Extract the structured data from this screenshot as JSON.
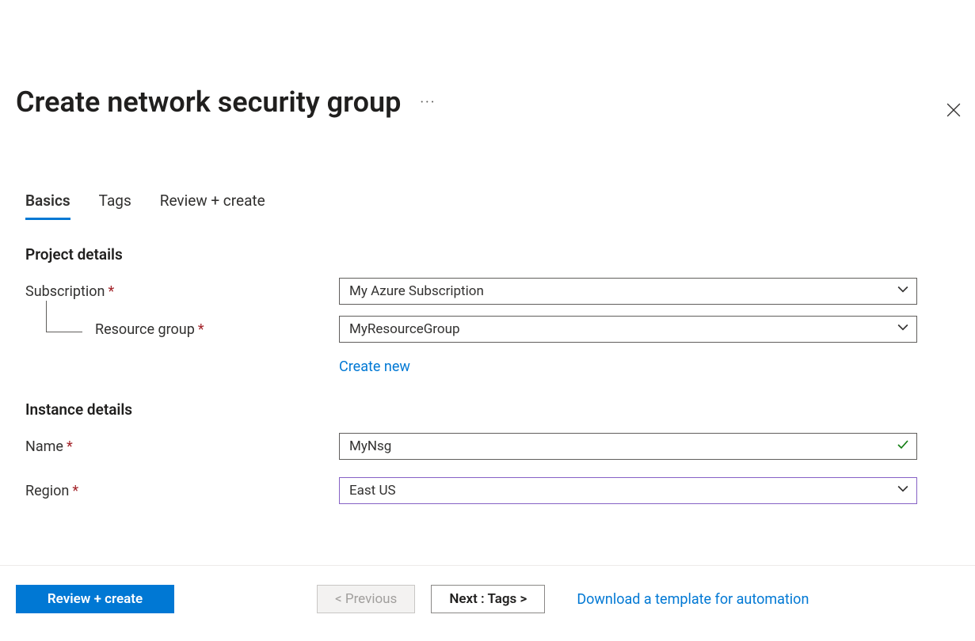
{
  "header": {
    "title": "Create network security group"
  },
  "tabs": {
    "basics": "Basics",
    "tags": "Tags",
    "review": "Review + create"
  },
  "sections": {
    "project": "Project details",
    "instance": "Instance details"
  },
  "fields": {
    "subscription": {
      "label": "Subscription",
      "value": "My Azure Subscription"
    },
    "resourceGroup": {
      "label": "Resource group",
      "value": "MyResourceGroup",
      "createNew": "Create new"
    },
    "name": {
      "label": "Name",
      "value": "MyNsg"
    },
    "region": {
      "label": "Region",
      "value": "East US"
    }
  },
  "footer": {
    "reviewCreate": "Review + create",
    "previous": "< Previous",
    "next": "Next : Tags >",
    "downloadTemplate": "Download a template for automation"
  }
}
